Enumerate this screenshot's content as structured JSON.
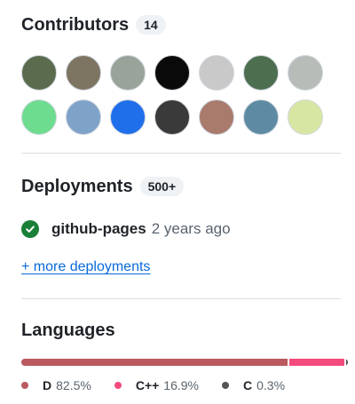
{
  "contributors": {
    "title": "Contributors",
    "count": "14",
    "avatars": [
      {
        "name": "contributor-avatar-1",
        "bg": "#5a6b4e"
      },
      {
        "name": "contributor-avatar-2",
        "bg": "#7e7462"
      },
      {
        "name": "contributor-avatar-3",
        "bg": "#9aa39a"
      },
      {
        "name": "contributor-avatar-4",
        "bg": "#0a0a0a"
      },
      {
        "name": "contributor-avatar-5",
        "bg": "#c9c9c9"
      },
      {
        "name": "contributor-avatar-6",
        "bg": "#4d6f50"
      },
      {
        "name": "contributor-avatar-7",
        "bg": "#b7bcb9"
      },
      {
        "name": "contributor-avatar-8",
        "bg": "#6ddc8e"
      },
      {
        "name": "contributor-avatar-9",
        "bg": "#7fa2c9"
      },
      {
        "name": "contributor-avatar-10",
        "bg": "#1f6feb"
      },
      {
        "name": "contributor-avatar-11",
        "bg": "#3a3a3a"
      },
      {
        "name": "contributor-avatar-12",
        "bg": "#a97b6d"
      },
      {
        "name": "contributor-avatar-13",
        "bg": "#5e8ba3"
      },
      {
        "name": "contributor-avatar-14",
        "bg": "#d8e6a4"
      }
    ]
  },
  "deployments": {
    "title": "Deployments",
    "count": "500+",
    "items": [
      {
        "environment": "github-pages",
        "time": "2 years ago",
        "status_color": "#1a7f37"
      }
    ],
    "more_link": "+ more deployments"
  },
  "languages": {
    "title": "Languages",
    "items": [
      {
        "name": "D",
        "percent": "82.5%",
        "value": 82.5,
        "color": "#ba595e"
      },
      {
        "name": "C++",
        "percent": "16.9%",
        "value": 16.9,
        "color": "#f34b7d"
      },
      {
        "name": "C",
        "percent": "0.3%",
        "value": 0.3,
        "color": "#555555"
      }
    ]
  }
}
